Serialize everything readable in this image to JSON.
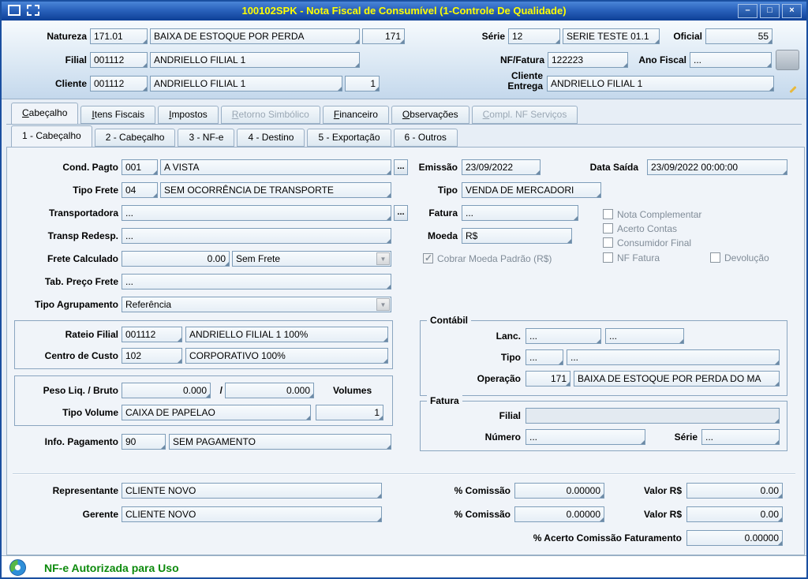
{
  "window": {
    "title": "100102SPK - Nota Fiscal de Consumível (1-Controle De Qualidade)",
    "controls": {
      "minimize": "–",
      "maximize": "□",
      "close": "×"
    }
  },
  "header": {
    "natureza_label": "Natureza",
    "natureza_code": "171.01",
    "natureza_desc": "BAIXA DE ESTOQUE POR PERDA",
    "natureza_num": "171",
    "serie_label": "Série",
    "serie_code": "12",
    "serie_desc": "SERIE TESTE 01.1",
    "oficial_label": "Oficial",
    "oficial_value": "55",
    "filial_label": "Filial",
    "filial_code": "001112",
    "filial_desc": "ANDRIELLO FILIAL 1",
    "nf_label": "NF/Fatura",
    "nf_value": "122223",
    "ano_label": "Ano Fiscal",
    "ano_value": "...",
    "cliente_label": "Cliente",
    "cliente_code": "001112",
    "cliente_desc": "ANDRIELLO FILIAL 1",
    "cliente_loja": "1",
    "entrega_label": "Cliente Entrega",
    "entrega_value": "ANDRIELLO FILIAL 1"
  },
  "tabs": {
    "main": [
      {
        "label": "Cabeçalho"
      },
      {
        "label": "Itens Fiscais"
      },
      {
        "label": "Impostos"
      },
      {
        "label": "Retorno Simbólico"
      },
      {
        "label": "Financeiro"
      },
      {
        "label": "Observações"
      },
      {
        "label": "Compl. NF Serviços"
      }
    ],
    "sub": [
      {
        "label": "1 - Cabeçalho"
      },
      {
        "label": "2 - Cabeçalho"
      },
      {
        "label": "3 - NF-e"
      },
      {
        "label": "4 - Destino"
      },
      {
        "label": "5 - Exportação"
      },
      {
        "label": "6 - Outros"
      }
    ]
  },
  "form": {
    "lookup_button": "...",
    "cond_pagto_label": "Cond. Pagto",
    "cond_pagto_code": "001",
    "cond_pagto_desc": "A VISTA",
    "emissao_label": "Emissão",
    "emissao_value": "23/09/2022",
    "data_saida_label": "Data Saída",
    "data_saida_value": "23/09/2022 00:00:00",
    "tipo_frete_label": "Tipo Frete",
    "tipo_frete_code": "04",
    "tipo_frete_desc": "SEM OCORRÊNCIA DE TRANSPORTE",
    "tipo_label": "Tipo",
    "tipo_value": "VENDA DE MERCADORI",
    "transportadora_label": "Transportadora",
    "transportadora_value": "...",
    "fatura_label": "Fatura",
    "fatura_value": "...",
    "transp_redesp_label": "Transp Redesp.",
    "transp_redesp_value": "...",
    "moeda_label": "Moeda",
    "moeda_value": "R$",
    "frete_calculado_label": "Frete Calculado",
    "frete_calculado_value": "0.00",
    "frete_tipo_value": "Sem Frete",
    "cobrar_moeda_label": "Cobrar Moeda Padrão (R$)",
    "tab_preco_frete_label": "Tab. Preço Frete",
    "tab_preco_frete_value": "...",
    "tipo_agrupamento_label": "Tipo Agrupamento",
    "tipo_agrupamento_value": "Referência",
    "checkboxes": {
      "nota_complementar": "Nota Complementar",
      "acerto_contas": "Acerto Contas",
      "consumidor_final": "Consumidor Final",
      "nf_fatura": "NF Fatura",
      "devolucao": "Devolução"
    },
    "rateio_filial_label": "Rateio Filial",
    "rateio_filial_code": "001112",
    "rateio_filial_desc": "ANDRIELLO FILIAL 1 100%",
    "centro_custo_label": "Centro de Custo",
    "centro_custo_code": "102",
    "centro_custo_desc": "CORPORATIVO 100%",
    "contabil_title": "Contábil",
    "lanc_label": "Lanc.",
    "lanc_value1": "...",
    "lanc_value2": "...",
    "ctipo_label": "Tipo",
    "ctipo_value1": "...",
    "ctipo_value2": "...",
    "operacao_label": "Operação",
    "operacao_code": "171",
    "operacao_desc": "BAIXA DE ESTOQUE POR PERDA DO MA",
    "peso_label": "Peso Liq. / Bruto",
    "peso_liq": "0.000",
    "peso_sep": "/",
    "peso_bruto": "0.000",
    "volumes_label": "Volumes",
    "tipo_volume_label": "Tipo Volume",
    "tipo_volume_value": "CAIXA DE PAPELAO",
    "volumes_value": "1",
    "fatura_group_title": "Fatura",
    "ffilial_label": "Filial",
    "ffilial_value": "",
    "numero_label": "Número",
    "numero_value": "...",
    "fserie_label": "Série",
    "fserie_value": "...",
    "info_pagamento_label": "Info. Pagamento",
    "info_pagamento_code": "90",
    "info_pagamento_desc": "SEM PAGAMENTO"
  },
  "footer": {
    "representante_label": "Representante",
    "representante_value": "CLIENTE NOVO",
    "gerente_label": "Gerente",
    "gerente_value": "CLIENTE NOVO",
    "comissao1_label": "% Comissão",
    "comissao1_value": "0.00000",
    "valor1_label": "Valor R$",
    "valor1_value": "0.00",
    "comissao2_label": "% Comissão",
    "comissao2_value": "0.00000",
    "valor2_label": "Valor R$",
    "valor2_value": "0.00",
    "acerto_label": "% Acerto Comissão Faturamento",
    "acerto_value": "0.00000"
  },
  "statusbar": {
    "message": "NF-e Autorizada para Uso"
  }
}
